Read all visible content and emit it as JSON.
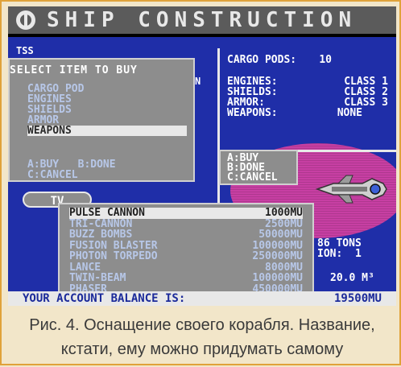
{
  "title": "SHIP CONSTRUCTION",
  "ship_name_left": "TSS",
  "ship_name_right": "N",
  "status": {
    "cargo_label": "CARGO PODS:",
    "cargo_value": "10",
    "rows": [
      {
        "label": "ENGINES:",
        "value": "CLASS 1"
      },
      {
        "label": "SHIELDS:",
        "value": "CLASS 2"
      },
      {
        "label": "ARMOR:",
        "value": "CLASS 3"
      },
      {
        "label": "WEAPONS:",
        "value": "NONE"
      }
    ]
  },
  "buy_menu": {
    "title": "SELECT ITEM TO BUY",
    "items": [
      "CARGO POD",
      "ENGINES",
      "SHIELDS",
      "ARMOR",
      "WEAPONS"
    ],
    "selected_index": 4,
    "keys_line1": "A:BUY   B:DONE",
    "keys_line2": "C:CANCEL"
  },
  "keys_right": [
    "A:BUY",
    "B:DONE",
    "C:CANCEL"
  ],
  "tv_label": "TV",
  "weapons": {
    "selected_index": 0,
    "items": [
      {
        "name": "PULSE CANNON",
        "price": "1000MU"
      },
      {
        "name": "TRI-CANNON",
        "price": "2500MU"
      },
      {
        "name": "BUZZ BOMBS",
        "price": "50000MU"
      },
      {
        "name": "FUSION BLASTER",
        "price": "100000MU"
      },
      {
        "name": "PHOTON TORPEDO",
        "price": "250000MU"
      },
      {
        "name": "LANCE",
        "price": "8000MU"
      },
      {
        "name": "TWIN-BEAM",
        "price": "100000MU"
      },
      {
        "name": "PHASER",
        "price": "450000MU"
      }
    ]
  },
  "right_extra": {
    "line1": "86 TONS",
    "line2": "ION:  1",
    "volume": "20.0 M³"
  },
  "balance": {
    "label": "YOUR ACCOUNT BALANCE IS:",
    "value": "19500MU"
  },
  "caption": "Рис. 4. Оснащение своего корабля. Название, кстати, ему можно придумать самому",
  "colors": {
    "screen_bg": "#1f2ea8",
    "panel_gray": "#8d8d8d",
    "highlight": "#e8e8e8",
    "ship_oval": "#c73fa3",
    "frame_border": "#e0a23a",
    "caption_bg": "#f2e6c9"
  }
}
